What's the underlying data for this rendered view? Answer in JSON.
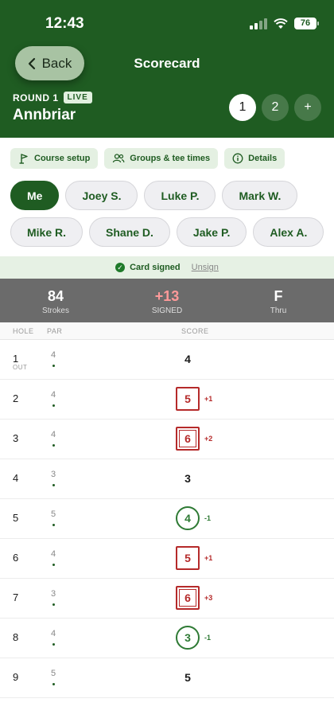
{
  "status_bar": {
    "time": "12:43",
    "battery": "76"
  },
  "header": {
    "back_label": "Back",
    "title": "Scorecard",
    "round_label": "ROUND 1",
    "live_badge": "LIVE",
    "course_name": "Annbriar",
    "round_tabs": [
      "1",
      "2",
      "+"
    ],
    "active_round": "1"
  },
  "actions": [
    {
      "label": "Course setup",
      "icon": "flag-icon"
    },
    {
      "label": "Groups & tee times",
      "icon": "users-icon"
    },
    {
      "label": "Details",
      "icon": "info-icon"
    }
  ],
  "players": [
    "Me",
    "Joey S.",
    "Luke P.",
    "Mark W.",
    "Mike R.",
    "Shane D.",
    "Jake P.",
    "Alex A."
  ],
  "active_player": "Me",
  "card_status": {
    "text": "Card signed",
    "unsign_label": "Unsign"
  },
  "summary": {
    "strokes_value": "84",
    "strokes_label": "Strokes",
    "to_par_value": "+13",
    "to_par_label": "SIGNED",
    "thru_value": "F",
    "thru_label": "Thru"
  },
  "columns": {
    "hole": "HOLE",
    "par": "PAR",
    "score": "SCORE"
  },
  "holes": [
    {
      "hole": "1",
      "sub": "OUT",
      "par": "4",
      "score": "4",
      "diff": "",
      "type": "par"
    },
    {
      "hole": "2",
      "sub": "",
      "par": "4",
      "score": "5",
      "diff": "+1",
      "type": "bogey"
    },
    {
      "hole": "3",
      "sub": "",
      "par": "4",
      "score": "6",
      "diff": "+2",
      "type": "double"
    },
    {
      "hole": "4",
      "sub": "",
      "par": "3",
      "score": "3",
      "diff": "",
      "type": "par"
    },
    {
      "hole": "5",
      "sub": "",
      "par": "5",
      "score": "4",
      "diff": "-1",
      "type": "birdie"
    },
    {
      "hole": "6",
      "sub": "",
      "par": "4",
      "score": "5",
      "diff": "+1",
      "type": "bogey"
    },
    {
      "hole": "7",
      "sub": "",
      "par": "3",
      "score": "6",
      "diff": "+3",
      "type": "double"
    },
    {
      "hole": "8",
      "sub": "",
      "par": "4",
      "score": "3",
      "diff": "-1",
      "type": "birdie"
    },
    {
      "hole": "9",
      "sub": "",
      "par": "5",
      "score": "5",
      "diff": "",
      "type": "par"
    }
  ],
  "colors": {
    "brand_green": "#1f5c22",
    "over_par": "#b52a2a",
    "under_par": "#2e7a34"
  }
}
